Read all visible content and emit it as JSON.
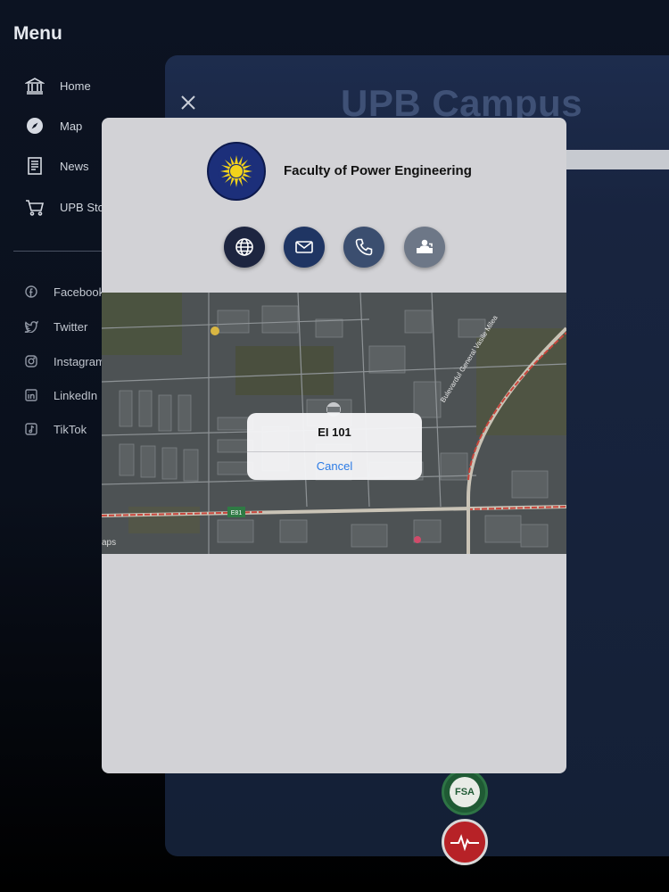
{
  "menu": {
    "title": "Menu",
    "items": [
      {
        "label": "Home",
        "icon": "bank-icon"
      },
      {
        "label": "Map",
        "icon": "compass-icon"
      },
      {
        "label": "News",
        "icon": "newspaper-icon"
      },
      {
        "label": "UPB Sto",
        "icon": "cart-icon"
      }
    ],
    "social": [
      {
        "label": "Facebook",
        "icon": "facebook-icon"
      },
      {
        "label": "Twitter",
        "icon": "twitter-icon"
      },
      {
        "label": "Instagram",
        "icon": "instagram-icon"
      },
      {
        "label": "LinkedIn",
        "icon": "linkedin-icon"
      },
      {
        "label": "TikTok",
        "icon": "tiktok-icon"
      }
    ]
  },
  "main": {
    "title": "UPB Campus",
    "logos": [
      {
        "label": "FSA"
      }
    ]
  },
  "sheet": {
    "faculty_name": "Faculty of Power Engineering",
    "actions": [
      {
        "name": "website",
        "icon": "globe-icon",
        "color": "#1d2540"
      },
      {
        "name": "email",
        "icon": "envelope-icon",
        "color": "#1f3563"
      },
      {
        "name": "phone",
        "icon": "phone-icon",
        "color": "#3b4e6f"
      },
      {
        "name": "office",
        "icon": "reception-icon",
        "color": "#6d7787"
      }
    ],
    "map": {
      "attribution": "aps",
      "road_label": "E81",
      "street_label": "Bulevardul General Vasile Milea"
    }
  },
  "alert": {
    "title": "EI 101",
    "cancel_label": "Cancel"
  },
  "colors": {
    "background": "#0c1322",
    "panel": "#18243f",
    "sheet": "#d2d2d6",
    "link_blue": "#2c7be5"
  }
}
